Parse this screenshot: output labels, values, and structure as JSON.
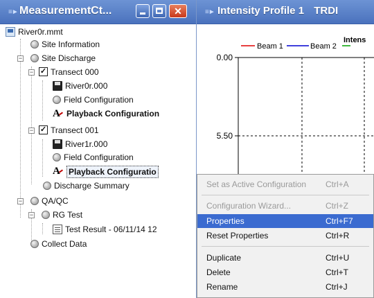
{
  "left_window": {
    "title": "MeasurementCt...",
    "tree": {
      "root": "River0r.mmt",
      "site_information": "Site Information",
      "site_discharge": "Site Discharge",
      "transect0": "Transect 000",
      "transect0_file": "River0r.000",
      "transect0_field": "Field Configuration",
      "transect0_playback": "Playback Configuration",
      "transect1": "Transect 001",
      "transect1_file": "River1r.000",
      "transect1_field": "Field Configuration",
      "transect1_playback": "Playback Configuratio",
      "discharge_summary": "Discharge Summary",
      "qaqc": "QA/QC",
      "rg_test": "RG Test",
      "test_result": "Test Result - 06/11/14 12",
      "collect_data": "Collect Data"
    }
  },
  "right_window": {
    "title": "Intensity Profile 1",
    "title_suffix": "TRDI",
    "chart_title_partial": "Intens",
    "legend": [
      "Beam 1",
      "Beam 2"
    ],
    "legend_colors": [
      "#e00000",
      "#0000d0",
      "#00a000"
    ],
    "y_ticks": [
      "0.00",
      "5.50"
    ]
  },
  "context_menu": {
    "items": [
      {
        "label": "Set as Active Configuration",
        "shortcut": "Ctrl+A",
        "state": "disabled"
      },
      {
        "label": "Configuration Wizard...",
        "shortcut": "Ctrl+Z",
        "state": "disabled"
      },
      {
        "label": "Properties",
        "shortcut": "Ctrl+F7",
        "state": "highlighted"
      },
      {
        "label": "Reset Properties",
        "shortcut": "Ctrl+R",
        "state": "enabled"
      },
      {
        "label": "Duplicate",
        "shortcut": "Ctrl+U",
        "state": "enabled"
      },
      {
        "label": "Delete",
        "shortcut": "Ctrl+T",
        "state": "enabled"
      },
      {
        "label": "Rename",
        "shortcut": "Ctrl+J",
        "state": "enabled"
      }
    ]
  },
  "colors": {
    "titlebar": "#4a72bd",
    "menu_highlight": "#3b6bd0",
    "close_button": "#c8391c"
  }
}
